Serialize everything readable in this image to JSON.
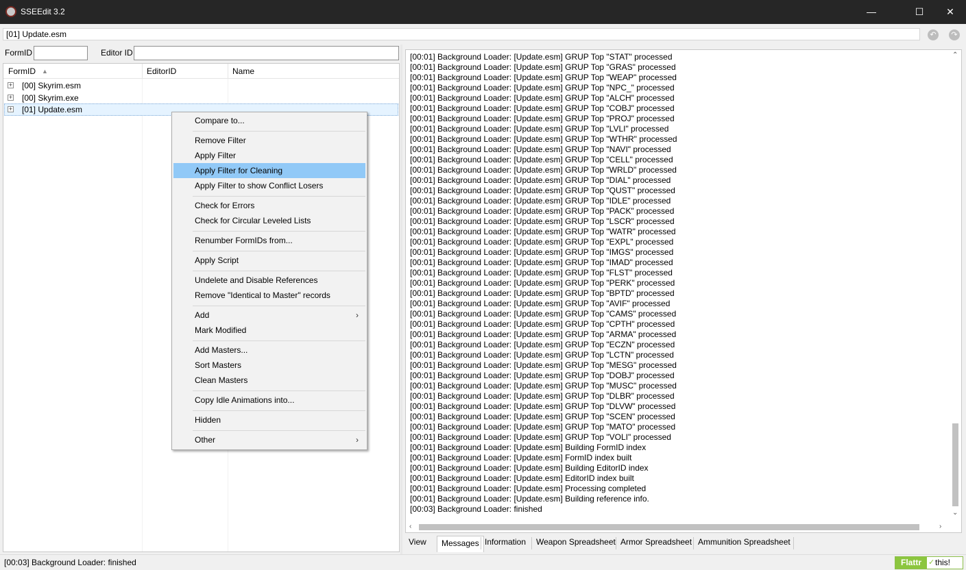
{
  "window": {
    "title": "SSEEdit 3.2",
    "minimize_icon": "minimize-icon",
    "maximize_icon": "maximize-icon",
    "close_icon": "close-icon"
  },
  "topbar": {
    "path_value": "[01] Update.esm",
    "back_icon": "back-icon",
    "forward_icon": "forward-icon"
  },
  "filter": {
    "formid_label": "FormID",
    "formid_value": "",
    "editorid_label": "Editor ID",
    "editorid_value": ""
  },
  "tree": {
    "columns": [
      "FormID",
      "EditorID",
      "Name"
    ],
    "rows": [
      {
        "label": "[00] Skyrim.esm",
        "selected": false
      },
      {
        "label": "[00] Skyrim.exe",
        "selected": false
      },
      {
        "label": "[01] Update.esm",
        "selected": true
      }
    ]
  },
  "context_menu": {
    "items": [
      {
        "label": "Compare to...",
        "highlighted": false,
        "submenu": false
      },
      {
        "label": "Remove Filter",
        "highlighted": false,
        "submenu": false
      },
      {
        "label": "Apply Filter",
        "highlighted": false,
        "submenu": false
      },
      {
        "label": "Apply Filter for Cleaning",
        "highlighted": true,
        "submenu": false
      },
      {
        "label": "Apply Filter to show Conflict Losers",
        "highlighted": false,
        "submenu": false
      },
      {
        "label": "Check for Errors",
        "highlighted": false,
        "submenu": false
      },
      {
        "label": "Check for Circular Leveled Lists",
        "highlighted": false,
        "submenu": false
      },
      {
        "label": "Renumber FormIDs from...",
        "highlighted": false,
        "submenu": false
      },
      {
        "label": "Apply Script",
        "highlighted": false,
        "submenu": false
      },
      {
        "label": "Undelete and Disable References",
        "highlighted": false,
        "submenu": false
      },
      {
        "label": "Remove \"Identical to Master\" records",
        "highlighted": false,
        "submenu": false
      },
      {
        "label": "Add",
        "highlighted": false,
        "submenu": true
      },
      {
        "label": "Mark Modified",
        "highlighted": false,
        "submenu": false
      },
      {
        "label": "Add Masters...",
        "highlighted": false,
        "submenu": false
      },
      {
        "label": "Sort Masters",
        "highlighted": false,
        "submenu": false
      },
      {
        "label": "Clean Masters",
        "highlighted": false,
        "submenu": false
      },
      {
        "label": "Copy Idle Animations into...",
        "highlighted": false,
        "submenu": false
      },
      {
        "label": "Hidden",
        "highlighted": false,
        "submenu": false
      },
      {
        "label": "Other",
        "highlighted": false,
        "submenu": true
      }
    ]
  },
  "log": {
    "lines": [
      "[00:01] Background Loader: [Update.esm] GRUP Top \"STAT\" processed",
      "[00:01] Background Loader: [Update.esm] GRUP Top \"GRAS\" processed",
      "[00:01] Background Loader: [Update.esm] GRUP Top \"WEAP\" processed",
      "[00:01] Background Loader: [Update.esm] GRUP Top \"NPC_\" processed",
      "[00:01] Background Loader: [Update.esm] GRUP Top \"ALCH\" processed",
      "[00:01] Background Loader: [Update.esm] GRUP Top \"COBJ\" processed",
      "[00:01] Background Loader: [Update.esm] GRUP Top \"PROJ\" processed",
      "[00:01] Background Loader: [Update.esm] GRUP Top \"LVLI\" processed",
      "[00:01] Background Loader: [Update.esm] GRUP Top \"WTHR\" processed",
      "[00:01] Background Loader: [Update.esm] GRUP Top \"NAVI\" processed",
      "[00:01] Background Loader: [Update.esm] GRUP Top \"CELL\" processed",
      "[00:01] Background Loader: [Update.esm] GRUP Top \"WRLD\" processed",
      "[00:01] Background Loader: [Update.esm] GRUP Top \"DIAL\" processed",
      "[00:01] Background Loader: [Update.esm] GRUP Top \"QUST\" processed",
      "[00:01] Background Loader: [Update.esm] GRUP Top \"IDLE\" processed",
      "[00:01] Background Loader: [Update.esm] GRUP Top \"PACK\" processed",
      "[00:01] Background Loader: [Update.esm] GRUP Top \"LSCR\" processed",
      "[00:01] Background Loader: [Update.esm] GRUP Top \"WATR\" processed",
      "[00:01] Background Loader: [Update.esm] GRUP Top \"EXPL\" processed",
      "[00:01] Background Loader: [Update.esm] GRUP Top \"IMGS\" processed",
      "[00:01] Background Loader: [Update.esm] GRUP Top \"IMAD\" processed",
      "[00:01] Background Loader: [Update.esm] GRUP Top \"FLST\" processed",
      "[00:01] Background Loader: [Update.esm] GRUP Top \"PERK\" processed",
      "[00:01] Background Loader: [Update.esm] GRUP Top \"BPTD\" processed",
      "[00:01] Background Loader: [Update.esm] GRUP Top \"AVIF\" processed",
      "[00:01] Background Loader: [Update.esm] GRUP Top \"CAMS\" processed",
      "[00:01] Background Loader: [Update.esm] GRUP Top \"CPTH\" processed",
      "[00:01] Background Loader: [Update.esm] GRUP Top \"ARMA\" processed",
      "[00:01] Background Loader: [Update.esm] GRUP Top \"ECZN\" processed",
      "[00:01] Background Loader: [Update.esm] GRUP Top \"LCTN\" processed",
      "[00:01] Background Loader: [Update.esm] GRUP Top \"MESG\" processed",
      "[00:01] Background Loader: [Update.esm] GRUP Top \"DOBJ\" processed",
      "[00:01] Background Loader: [Update.esm] GRUP Top \"MUSC\" processed",
      "[00:01] Background Loader: [Update.esm] GRUP Top \"DLBR\" processed",
      "[00:01] Background Loader: [Update.esm] GRUP Top \"DLVW\" processed",
      "[00:01] Background Loader: [Update.esm] GRUP Top \"SCEN\" processed",
      "[00:01] Background Loader: [Update.esm] GRUP Top \"MATO\" processed",
      "[00:01] Background Loader: [Update.esm] GRUP Top \"VOLI\" processed",
      "[00:01] Background Loader: [Update.esm] Building FormID index",
      "[00:01] Background Loader: [Update.esm] FormID index built",
      "[00:01] Background Loader: [Update.esm] Building EditorID index",
      "[00:01] Background Loader: [Update.esm] EditorID index built",
      "[00:01] Background Loader: [Update.esm] Processing completed",
      "[00:01] Background Loader: [Update.esm] Building reference info.",
      "[00:03] Background Loader: finished"
    ]
  },
  "tabs": [
    {
      "label": "View",
      "active": false
    },
    {
      "label": "Messages",
      "active": true
    },
    {
      "label": "Information",
      "active": false
    },
    {
      "label": "Weapon Spreadsheet",
      "active": false
    },
    {
      "label": "Armor Spreadsheet",
      "active": false
    },
    {
      "label": "Ammunition Spreadsheet",
      "active": false
    }
  ],
  "status": {
    "text": "[00:03] Background Loader: finished",
    "flattr_label": "Flattr",
    "flattr_this": "this!"
  },
  "colors": {
    "titlebar": "#262626",
    "menu_highlight": "#91c9f7",
    "selection": "#e5f3ff",
    "flattr_green": "#8cc63f"
  }
}
